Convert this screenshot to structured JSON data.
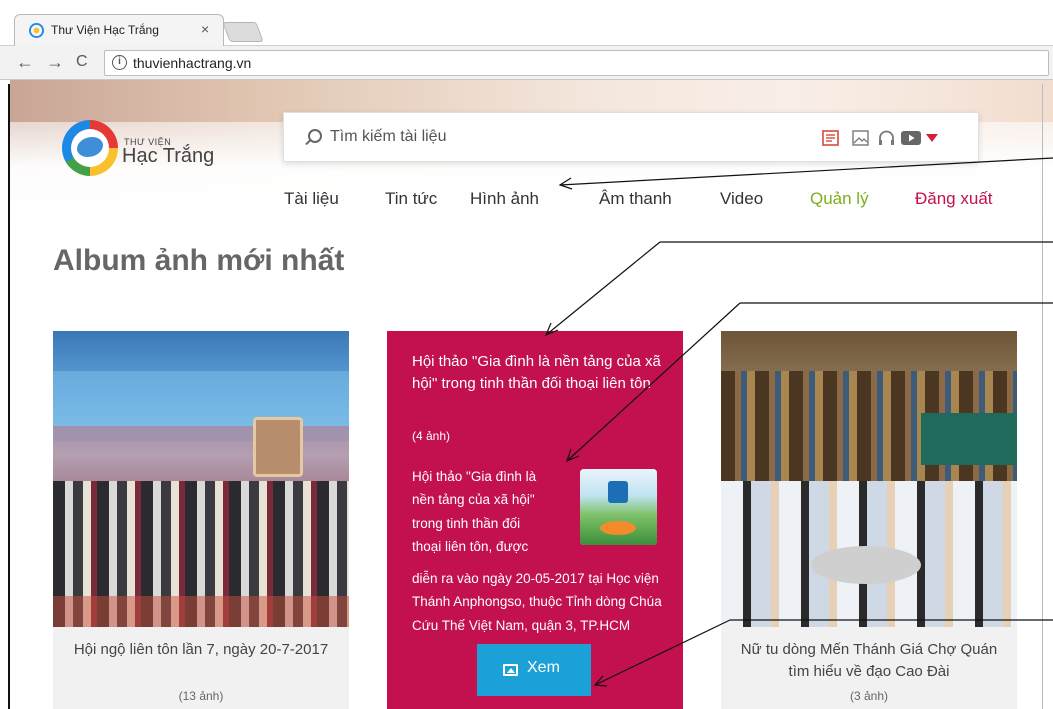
{
  "browser": {
    "tab_title": "Thư Viện Hạc Trắng",
    "tab_close": "×",
    "back": "←",
    "forward": "→",
    "reload": "C",
    "info": "i",
    "url": "thuvienhactrang.vn"
  },
  "site": {
    "logo_small": "THƯ VIỆN",
    "logo_big": "Hạc Trắng",
    "search_placeholder": "Tìm kiếm tài liệu",
    "nav": [
      {
        "label": "Tài liệu",
        "color": "#333333"
      },
      {
        "label": "Tin tức",
        "color": "#333333"
      },
      {
        "label": "Hình ảnh",
        "color": "#333333"
      },
      {
        "label": "Âm thanh",
        "color": "#333333"
      },
      {
        "label": "Video",
        "color": "#333333"
      },
      {
        "label": "Quản lý",
        "color": "#7cae1e"
      },
      {
        "label": "Đăng xuất",
        "color": "#c2114e"
      }
    ],
    "filter_icons": [
      "document-icon",
      "image-icon",
      "headphones-icon",
      "video-icon",
      "dropdown-caret-icon"
    ],
    "accent": "#c2114e",
    "button_color": "#1ba0d8"
  },
  "main": {
    "section_title": "Album ảnh mới nhất",
    "albums": [
      {
        "title": "Hội ngộ liên tôn lần 7, ngày 20-7-2017",
        "count": "(13 ảnh)"
      },
      {
        "title": "Hội thảo \"Gia đình là nền tảng của xã hội\" trong tinh thần đối thoại liên tôn",
        "count": "(4 ảnh)",
        "desc_lines": [
          "Hội thảo \"Gia đình là",
          "nền tảng của xã hội\"",
          "trong tinh thần đối",
          "thoại liên tôn, được"
        ],
        "desc_rest": "diễn ra vào ngày 20-05-2017 tại Học viện Thánh Anphongso, thuộc Tỉnh dòng Chúa Cứu Thế Việt Nam, quận 3, TP.HCM",
        "button_label": "Xem"
      },
      {
        "title": "Nữ tu dòng Mến Thánh Giá Chợ Quán tìm hiểu về đạo Cao Đài",
        "count": "(3 ảnh)"
      }
    ]
  }
}
